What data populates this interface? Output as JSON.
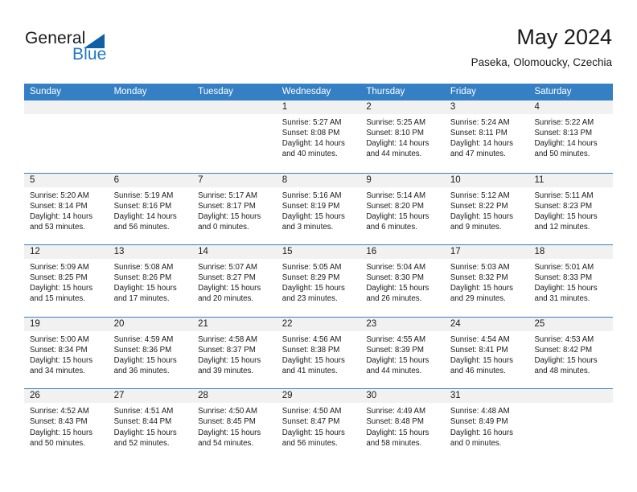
{
  "brand": {
    "name_top": "General",
    "name_bottom": "Blue",
    "accent_color": "#2079c4",
    "triangle_color": "#1060a8"
  },
  "header": {
    "title": "May 2024",
    "subtitle": "Paseka, Olomoucky, Czechia"
  },
  "calendar": {
    "header_bg": "#3580c4",
    "daynum_bg": "#f1f1f1",
    "weekday_labels": [
      "Sunday",
      "Monday",
      "Tuesday",
      "Wednesday",
      "Thursday",
      "Friday",
      "Saturday"
    ],
    "weeks": [
      [
        {
          "day": "",
          "empty": true
        },
        {
          "day": "",
          "empty": true
        },
        {
          "day": "",
          "empty": true
        },
        {
          "day": "1",
          "sunrise": "Sunrise: 5:27 AM",
          "sunset": "Sunset: 8:08 PM",
          "daylight1": "Daylight: 14 hours",
          "daylight2": "and 40 minutes."
        },
        {
          "day": "2",
          "sunrise": "Sunrise: 5:25 AM",
          "sunset": "Sunset: 8:10 PM",
          "daylight1": "Daylight: 14 hours",
          "daylight2": "and 44 minutes."
        },
        {
          "day": "3",
          "sunrise": "Sunrise: 5:24 AM",
          "sunset": "Sunset: 8:11 PM",
          "daylight1": "Daylight: 14 hours",
          "daylight2": "and 47 minutes."
        },
        {
          "day": "4",
          "sunrise": "Sunrise: 5:22 AM",
          "sunset": "Sunset: 8:13 PM",
          "daylight1": "Daylight: 14 hours",
          "daylight2": "and 50 minutes."
        }
      ],
      [
        {
          "day": "5",
          "sunrise": "Sunrise: 5:20 AM",
          "sunset": "Sunset: 8:14 PM",
          "daylight1": "Daylight: 14 hours",
          "daylight2": "and 53 minutes."
        },
        {
          "day": "6",
          "sunrise": "Sunrise: 5:19 AM",
          "sunset": "Sunset: 8:16 PM",
          "daylight1": "Daylight: 14 hours",
          "daylight2": "and 56 minutes."
        },
        {
          "day": "7",
          "sunrise": "Sunrise: 5:17 AM",
          "sunset": "Sunset: 8:17 PM",
          "daylight1": "Daylight: 15 hours",
          "daylight2": "and 0 minutes."
        },
        {
          "day": "8",
          "sunrise": "Sunrise: 5:16 AM",
          "sunset": "Sunset: 8:19 PM",
          "daylight1": "Daylight: 15 hours",
          "daylight2": "and 3 minutes."
        },
        {
          "day": "9",
          "sunrise": "Sunrise: 5:14 AM",
          "sunset": "Sunset: 8:20 PM",
          "daylight1": "Daylight: 15 hours",
          "daylight2": "and 6 minutes."
        },
        {
          "day": "10",
          "sunrise": "Sunrise: 5:12 AM",
          "sunset": "Sunset: 8:22 PM",
          "daylight1": "Daylight: 15 hours",
          "daylight2": "and 9 minutes."
        },
        {
          "day": "11",
          "sunrise": "Sunrise: 5:11 AM",
          "sunset": "Sunset: 8:23 PM",
          "daylight1": "Daylight: 15 hours",
          "daylight2": "and 12 minutes."
        }
      ],
      [
        {
          "day": "12",
          "sunrise": "Sunrise: 5:09 AM",
          "sunset": "Sunset: 8:25 PM",
          "daylight1": "Daylight: 15 hours",
          "daylight2": "and 15 minutes."
        },
        {
          "day": "13",
          "sunrise": "Sunrise: 5:08 AM",
          "sunset": "Sunset: 8:26 PM",
          "daylight1": "Daylight: 15 hours",
          "daylight2": "and 17 minutes."
        },
        {
          "day": "14",
          "sunrise": "Sunrise: 5:07 AM",
          "sunset": "Sunset: 8:27 PM",
          "daylight1": "Daylight: 15 hours",
          "daylight2": "and 20 minutes."
        },
        {
          "day": "15",
          "sunrise": "Sunrise: 5:05 AM",
          "sunset": "Sunset: 8:29 PM",
          "daylight1": "Daylight: 15 hours",
          "daylight2": "and 23 minutes."
        },
        {
          "day": "16",
          "sunrise": "Sunrise: 5:04 AM",
          "sunset": "Sunset: 8:30 PM",
          "daylight1": "Daylight: 15 hours",
          "daylight2": "and 26 minutes."
        },
        {
          "day": "17",
          "sunrise": "Sunrise: 5:03 AM",
          "sunset": "Sunset: 8:32 PM",
          "daylight1": "Daylight: 15 hours",
          "daylight2": "and 29 minutes."
        },
        {
          "day": "18",
          "sunrise": "Sunrise: 5:01 AM",
          "sunset": "Sunset: 8:33 PM",
          "daylight1": "Daylight: 15 hours",
          "daylight2": "and 31 minutes."
        }
      ],
      [
        {
          "day": "19",
          "sunrise": "Sunrise: 5:00 AM",
          "sunset": "Sunset: 8:34 PM",
          "daylight1": "Daylight: 15 hours",
          "daylight2": "and 34 minutes."
        },
        {
          "day": "20",
          "sunrise": "Sunrise: 4:59 AM",
          "sunset": "Sunset: 8:36 PM",
          "daylight1": "Daylight: 15 hours",
          "daylight2": "and 36 minutes."
        },
        {
          "day": "21",
          "sunrise": "Sunrise: 4:58 AM",
          "sunset": "Sunset: 8:37 PM",
          "daylight1": "Daylight: 15 hours",
          "daylight2": "and 39 minutes."
        },
        {
          "day": "22",
          "sunrise": "Sunrise: 4:56 AM",
          "sunset": "Sunset: 8:38 PM",
          "daylight1": "Daylight: 15 hours",
          "daylight2": "and 41 minutes."
        },
        {
          "day": "23",
          "sunrise": "Sunrise: 4:55 AM",
          "sunset": "Sunset: 8:39 PM",
          "daylight1": "Daylight: 15 hours",
          "daylight2": "and 44 minutes."
        },
        {
          "day": "24",
          "sunrise": "Sunrise: 4:54 AM",
          "sunset": "Sunset: 8:41 PM",
          "daylight1": "Daylight: 15 hours",
          "daylight2": "and 46 minutes."
        },
        {
          "day": "25",
          "sunrise": "Sunrise: 4:53 AM",
          "sunset": "Sunset: 8:42 PM",
          "daylight1": "Daylight: 15 hours",
          "daylight2": "and 48 minutes."
        }
      ],
      [
        {
          "day": "26",
          "sunrise": "Sunrise: 4:52 AM",
          "sunset": "Sunset: 8:43 PM",
          "daylight1": "Daylight: 15 hours",
          "daylight2": "and 50 minutes."
        },
        {
          "day": "27",
          "sunrise": "Sunrise: 4:51 AM",
          "sunset": "Sunset: 8:44 PM",
          "daylight1": "Daylight: 15 hours",
          "daylight2": "and 52 minutes."
        },
        {
          "day": "28",
          "sunrise": "Sunrise: 4:50 AM",
          "sunset": "Sunset: 8:45 PM",
          "daylight1": "Daylight: 15 hours",
          "daylight2": "and 54 minutes."
        },
        {
          "day": "29",
          "sunrise": "Sunrise: 4:50 AM",
          "sunset": "Sunset: 8:47 PM",
          "daylight1": "Daylight: 15 hours",
          "daylight2": "and 56 minutes."
        },
        {
          "day": "30",
          "sunrise": "Sunrise: 4:49 AM",
          "sunset": "Sunset: 8:48 PM",
          "daylight1": "Daylight: 15 hours",
          "daylight2": "and 58 minutes."
        },
        {
          "day": "31",
          "sunrise": "Sunrise: 4:48 AM",
          "sunset": "Sunset: 8:49 PM",
          "daylight1": "Daylight: 16 hours",
          "daylight2": "and 0 minutes."
        },
        {
          "day": "",
          "empty": true
        }
      ]
    ]
  }
}
